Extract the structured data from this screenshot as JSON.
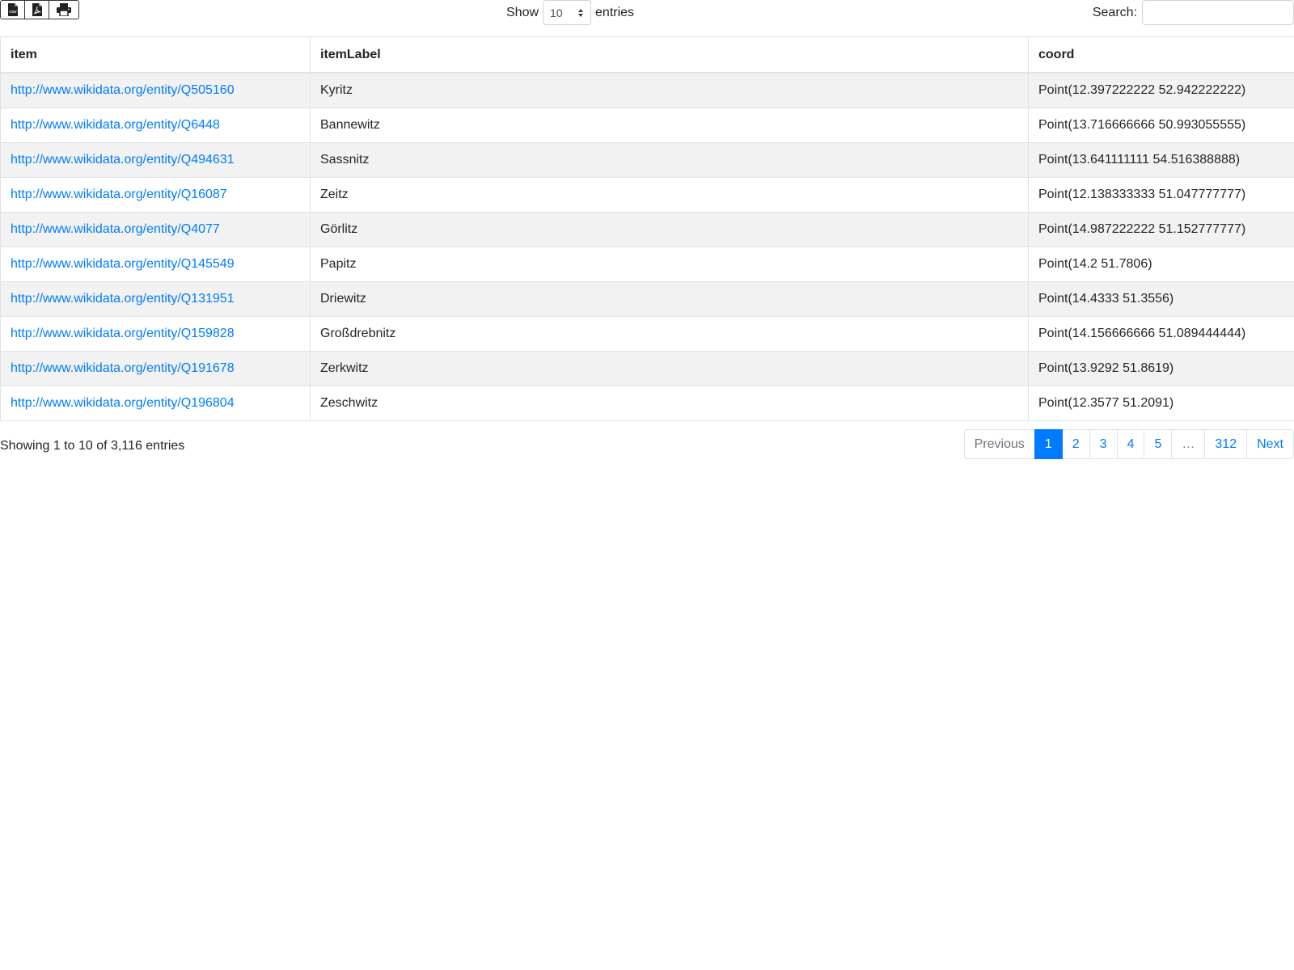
{
  "toolbar": {
    "buttons": [
      {
        "icon": "csv-file-icon",
        "label": "CSV"
      },
      {
        "icon": "pdf-file-icon",
        "label": "PDF"
      },
      {
        "icon": "print-icon",
        "label": "Print"
      }
    ]
  },
  "length": {
    "show_label": "Show",
    "selected": "10",
    "entries_label": "entries"
  },
  "search": {
    "label": "Search:",
    "value": "",
    "placeholder": ""
  },
  "table": {
    "columns": [
      "item",
      "itemLabel",
      "coord"
    ],
    "rows": [
      {
        "item": "http://www.wikidata.org/entity/Q505160",
        "itemLabel": "Kyritz",
        "coord": "Point(12.397222222 52.942222222)"
      },
      {
        "item": "http://www.wikidata.org/entity/Q6448",
        "itemLabel": "Bannewitz",
        "coord": "Point(13.716666666 50.993055555)"
      },
      {
        "item": "http://www.wikidata.org/entity/Q494631",
        "itemLabel": "Sassnitz",
        "coord": "Point(13.641111111 54.516388888)"
      },
      {
        "item": "http://www.wikidata.org/entity/Q16087",
        "itemLabel": "Zeitz",
        "coord": "Point(12.138333333 51.047777777)"
      },
      {
        "item": "http://www.wikidata.org/entity/Q4077",
        "itemLabel": "Görlitz",
        "coord": "Point(14.987222222 51.152777777)"
      },
      {
        "item": "http://www.wikidata.org/entity/Q145549",
        "itemLabel": "Papitz",
        "coord": "Point(14.2 51.7806)"
      },
      {
        "item": "http://www.wikidata.org/entity/Q131951",
        "itemLabel": "Driewitz",
        "coord": "Point(14.4333 51.3556)"
      },
      {
        "item": "http://www.wikidata.org/entity/Q159828",
        "itemLabel": "Großdrebnitz",
        "coord": "Point(14.156666666 51.089444444)"
      },
      {
        "item": "http://www.wikidata.org/entity/Q191678",
        "itemLabel": "Zerkwitz",
        "coord": "Point(13.9292 51.8619)"
      },
      {
        "item": "http://www.wikidata.org/entity/Q196804",
        "itemLabel": "Zeschwitz",
        "coord": "Point(12.3577 51.2091)"
      }
    ]
  },
  "footer": {
    "info": "Showing 1 to 10 of 3,116 entries",
    "pagination": {
      "previous": "Previous",
      "pages": [
        "1",
        "2",
        "3",
        "4",
        "5"
      ],
      "ellipsis": "…",
      "last": "312",
      "next": "Next",
      "active": "1"
    }
  },
  "colors": {
    "link": "#007bff",
    "active_page_bg": "#007bff",
    "stripe": "#f2f2f2",
    "border": "#dee2e6"
  }
}
